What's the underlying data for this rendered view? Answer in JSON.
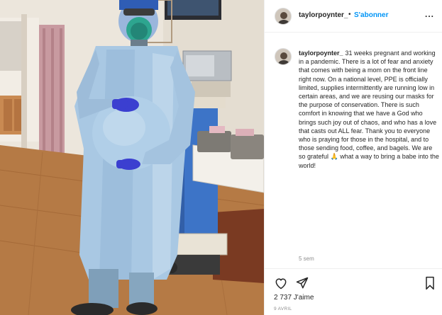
{
  "post": {
    "username": "taylorpoynter_",
    "dot": "•",
    "follow_label": "S'abonner",
    "more_label": "...",
    "caption_text": "31 weeks pregnant and working in a pandemic. There is a lot of fear and anxiety that comes with being a mom on the front line right now. On a national level, PPE is officially limited, supplies intermittently are running low in certain areas, and we are reusing our masks for the purpose of conservation. There is such comfort in knowing that we have a God who brings such joy out of chaos, and who has a love that casts out ALL fear. Thank you to everyone who is praying for those in the hospital, and to those sending food, coffee, and bagels. We are so grateful 🙏 what a way to bring a babe into the world!",
    "time_ago": "5 sem",
    "likes": "2 737 J'aime",
    "date": "9 AVRIL"
  },
  "icons": {
    "heart": "heart-icon",
    "share": "share-icon",
    "save": "bookmark-icon",
    "more": "more-icon"
  },
  "colors": {
    "follow": "#0095f6",
    "gown": "#a9c8e3",
    "gloves": "#3b3fd0",
    "floor": "#b97b45",
    "wall": "#efe9df",
    "cart": "#3d74c7"
  }
}
